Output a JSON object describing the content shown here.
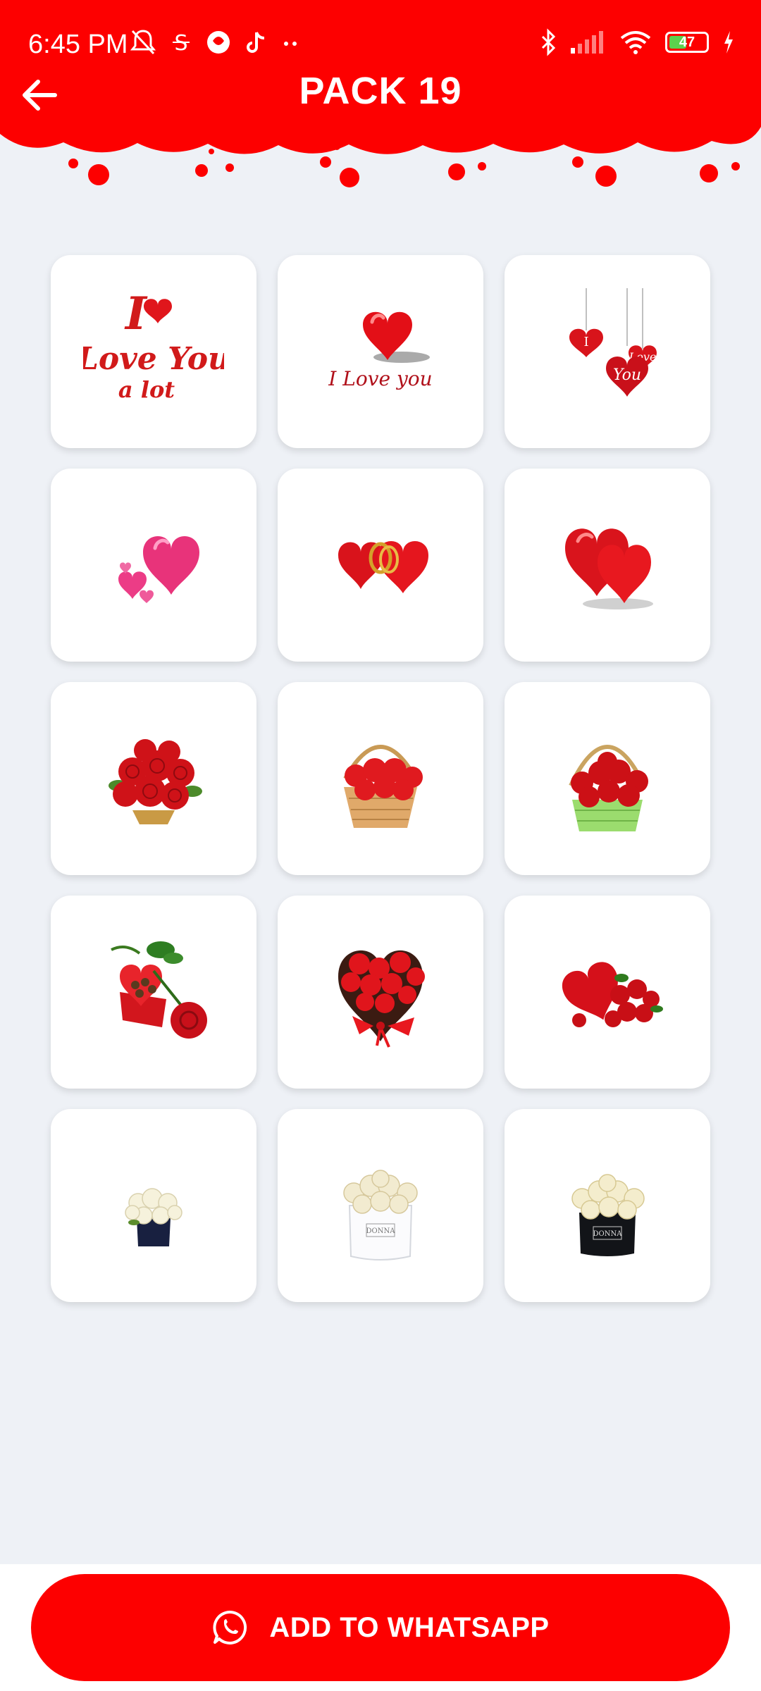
{
  "status_bar": {
    "time": "6:45 PM",
    "battery_level": "47",
    "left_icons": [
      "mute-icon",
      "app-icon",
      "maps-icon",
      "tiktok-icon",
      "more-dots-icon"
    ],
    "right_icons": [
      "bluetooth-icon",
      "signal-icon",
      "wifi-icon",
      "battery-icon",
      "charging-icon"
    ]
  },
  "header": {
    "title": "PACK 19",
    "back_icon": "arrow-left-icon",
    "background_color": "#fd0000"
  },
  "stickers": [
    {
      "name": "i-love-you-a-lot-text",
      "text": [
        "I",
        "Love You",
        "a lot"
      ]
    },
    {
      "name": "heart-i-love-you",
      "text": [
        "I Love you"
      ]
    },
    {
      "name": "hanging-hearts-i-love-you",
      "text": [
        "I",
        "Love",
        "You"
      ]
    },
    {
      "name": "pink-hearts"
    },
    {
      "name": "linked-hearts-rings"
    },
    {
      "name": "two-red-hearts"
    },
    {
      "name": "red-rose-bouquet"
    },
    {
      "name": "rose-basket"
    },
    {
      "name": "rose-green-basket"
    },
    {
      "name": "heart-box-chocolates-rose"
    },
    {
      "name": "heart-rose-box"
    },
    {
      "name": "red-heart-roses"
    },
    {
      "name": "white-roses-black-box"
    },
    {
      "name": "white-roses-donna-white-box",
      "text": [
        "DONNA"
      ]
    },
    {
      "name": "white-roses-donna-black-box",
      "text": [
        "DONNA"
      ]
    }
  ],
  "footer": {
    "button_label": "ADD TO WHATSAPP",
    "button_icon": "whatsapp-icon",
    "button_color": "#fd0000"
  }
}
